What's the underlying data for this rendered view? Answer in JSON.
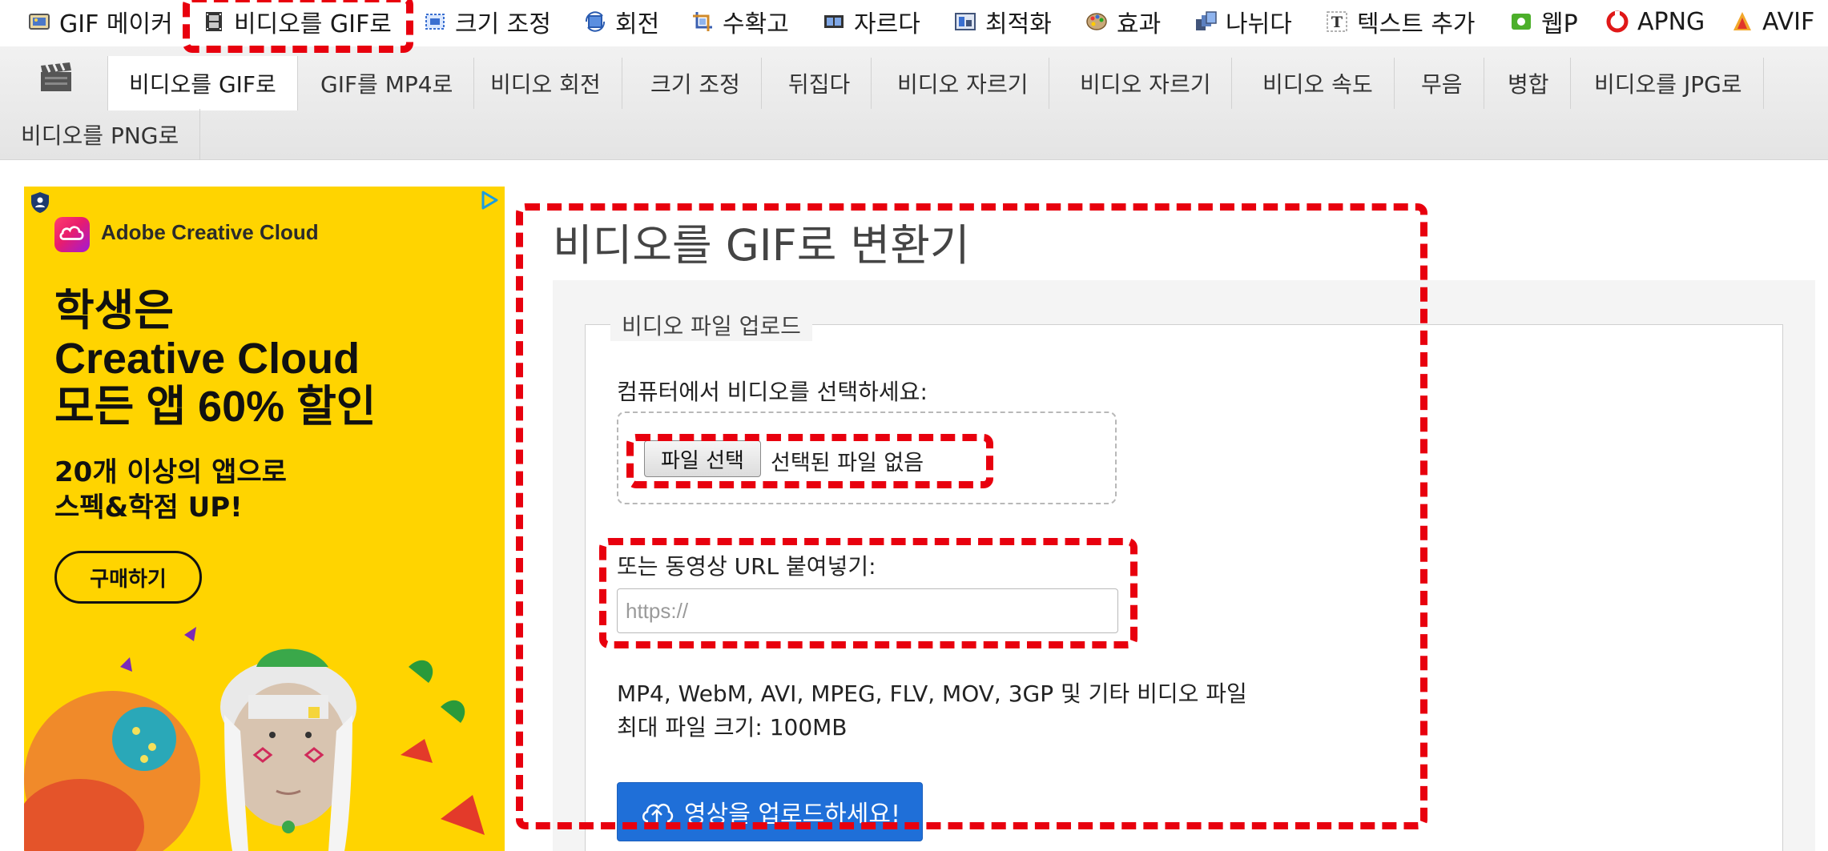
{
  "top_menu": [
    {
      "label": "GIF 메이커",
      "icon": "gif-maker-icon"
    },
    {
      "label": "비디오를 GIF로",
      "icon": "film-icon"
    },
    {
      "label": "크기 조정",
      "icon": "resize-icon"
    },
    {
      "label": "회전",
      "icon": "rotate-icon"
    },
    {
      "label": "수확고",
      "icon": "crop-icon"
    },
    {
      "label": "자르다",
      "icon": "cut-icon"
    },
    {
      "label": "최적화",
      "icon": "optimize-icon"
    },
    {
      "label": "효과",
      "icon": "palette-icon"
    },
    {
      "label": "나뉘다",
      "icon": "split-icon"
    },
    {
      "label": "텍스트 추가",
      "icon": "text-icon"
    },
    {
      "label": "웹P",
      "icon": "webp-icon"
    },
    {
      "label": "APNG",
      "icon": "apng-icon"
    },
    {
      "label": "AVIF",
      "icon": "avif-icon"
    }
  ],
  "sub_tabs": [
    {
      "label": "비디오를 GIF로",
      "active": true
    },
    {
      "label": "GIF를 MP4로"
    },
    {
      "label": "비디오 회전"
    },
    {
      "label": "크기 조정"
    },
    {
      "label": "뒤집다"
    },
    {
      "label": "비디오 자르기"
    },
    {
      "label": "비디오 자르기"
    },
    {
      "label": "비디오 속도"
    },
    {
      "label": "무음"
    },
    {
      "label": "병합"
    },
    {
      "label": "비디오를 JPG로"
    },
    {
      "label": "비디오를 PNG로"
    }
  ],
  "ad": {
    "brand": "Adobe Creative Cloud",
    "headline": [
      "학생은",
      "Creative Cloud",
      "모든 앱 60% 할인"
    ],
    "subline": [
      "20개 이상의 앱으로",
      "스펙&학점 UP!"
    ],
    "cta": "구매하기"
  },
  "main": {
    "title": "비디오를 GIF로 변환기",
    "legend": "비디오 파일 업로드",
    "choose_label": "컴퓨터에서 비디오를 선택하세요:",
    "file_button": "파일 선택",
    "no_file": "선택된 파일 없음",
    "url_label": "또는 동영상 URL 붙여넣기:",
    "url_placeholder": "https://",
    "formats": "MP4, WebM, AVI, MPEG, FLV, MOV, 3GP 및 기타 비디오 파일",
    "max_size": "최대 파일 크기: 100MB",
    "upload_button": "영상을 업로드하세요!"
  },
  "colors": {
    "ad_background": "#ffd400",
    "upload_button": "#1f6fd8",
    "highlight": "#e8000e",
    "tab_bar": "#e9e9e9"
  }
}
